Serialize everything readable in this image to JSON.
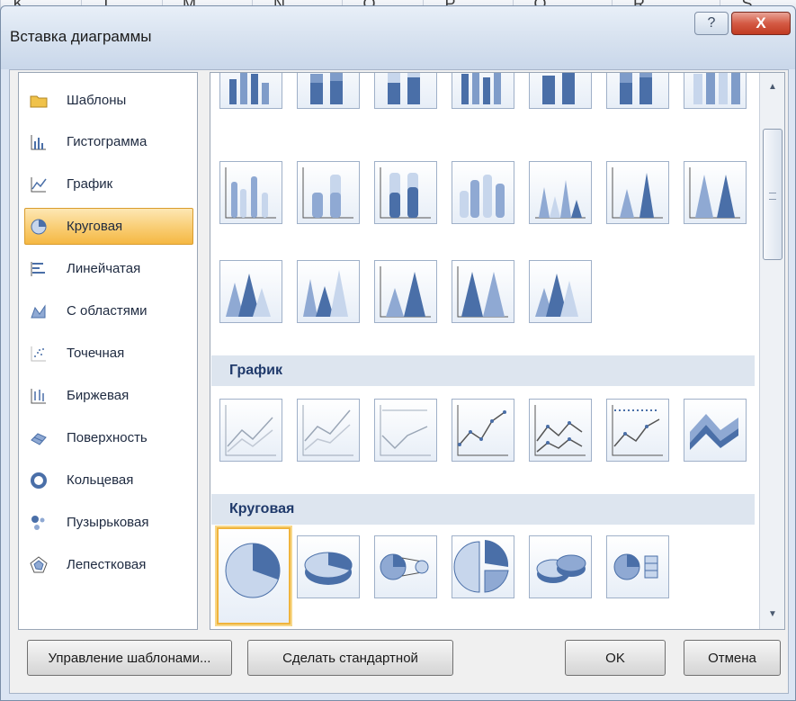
{
  "excel_columns": [
    "K",
    "L",
    "M",
    "N",
    "O",
    "P",
    "Q",
    "R",
    "S"
  ],
  "dialog": {
    "title": "Вставка диаграммы",
    "help_label": "?",
    "close_label": "X"
  },
  "categories": [
    {
      "label": "Шаблоны",
      "icon": "folder-icon"
    },
    {
      "label": "Гистограмма",
      "icon": "column-chart-icon"
    },
    {
      "label": "График",
      "icon": "line-chart-icon"
    },
    {
      "label": "Круговая",
      "icon": "pie-chart-icon",
      "selected": true
    },
    {
      "label": "Линейчатая",
      "icon": "bar-chart-icon"
    },
    {
      "label": "С областями",
      "icon": "area-chart-icon"
    },
    {
      "label": "Точечная",
      "icon": "scatter-chart-icon"
    },
    {
      "label": "Биржевая",
      "icon": "stock-chart-icon"
    },
    {
      "label": "Поверхность",
      "icon": "surface-chart-icon"
    },
    {
      "label": "Кольцевая",
      "icon": "doughnut-chart-icon"
    },
    {
      "label": "Пузырьковая",
      "icon": "bubble-chart-icon"
    },
    {
      "label": "Лепестковая",
      "icon": "radar-chart-icon"
    }
  ],
  "gallery": {
    "sections": [
      {
        "title": "График"
      },
      {
        "title": "Круговая"
      }
    ],
    "selected_thumb": "pie-2d"
  },
  "buttons": {
    "manage_templates": "Управление шаблонами...",
    "set_default": "Сделать стандартной",
    "ok": "OK",
    "cancel": "Отмена"
  },
  "colors": {
    "accent_selected": "#f5b843",
    "chart_blue": "#4a6fa8",
    "section_header_bg": "#dde5ef",
    "section_header_text": "#203a6b"
  }
}
